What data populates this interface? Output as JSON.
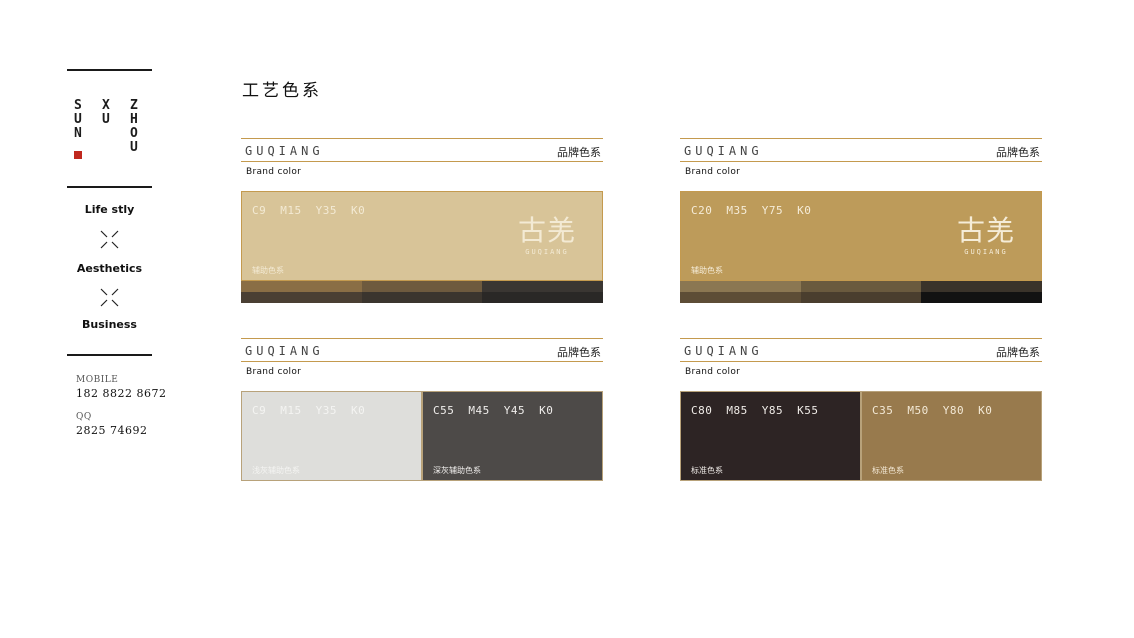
{
  "sidebar": {
    "logo_columns": [
      [
        "S",
        "U",
        "N"
      ],
      [
        "X",
        "U"
      ],
      [
        "Z",
        "H",
        "O",
        "U"
      ]
    ],
    "nav": [
      "Life stly",
      "Aesthetics",
      "Business"
    ],
    "contacts": [
      {
        "label": "MOBILE",
        "value": "182 8822 8672"
      },
      {
        "label": "QQ",
        "value": "2825 74692"
      }
    ]
  },
  "page": {
    "title": "工艺色系"
  },
  "panels": [
    {
      "wordmark": "GUQIANG",
      "tag": "品牌色系",
      "sub": "Brand color",
      "swatches": [
        {
          "cmyk": [
            "C9",
            "M15",
            "Y35",
            "K0"
          ],
          "name": "辅助色系",
          "color": "#d8c498",
          "text_color": "#f3ead4",
          "logo": true
        }
      ],
      "strips": [
        [
          "#8a6e45",
          "#6e5a3e",
          "#3a3632"
        ],
        [
          "#4a3f33",
          "#3b352e",
          "#2a2826"
        ]
      ]
    },
    {
      "wordmark": "GUQIANG",
      "tag": "品牌色系",
      "sub": "Brand color",
      "swatches": [
        {
          "cmyk": [
            "C20",
            "M35",
            "Y75",
            "K0"
          ],
          "name": "辅助色系",
          "color": "#bd9b5a",
          "text_color": "#f5ecd8",
          "logo": true
        }
      ],
      "strips": [
        [
          "#8b7752",
          "#6a5a3e",
          "#3a332a"
        ],
        [
          "#5d4d36",
          "#4a3e2e",
          "#121212"
        ]
      ]
    },
    {
      "wordmark": "GUQIANG",
      "tag": "品牌色系",
      "sub": "Brand color",
      "swatches": [
        {
          "cmyk": [
            "C9",
            "M15",
            "Y35",
            "K0"
          ],
          "name": "浅灰辅助色系",
          "color": "#dededb",
          "text_color": "#f4f4f2",
          "logo": false
        },
        {
          "cmyk": [
            "C55",
            "M45",
            "Y45",
            "K0"
          ],
          "name": "深灰辅助色系",
          "color": "#4d4a48",
          "text_color": "#f0eeec",
          "logo": false
        }
      ],
      "strips": []
    },
    {
      "wordmark": "GUQIANG",
      "tag": "品牌色系",
      "sub": "Brand color",
      "swatches": [
        {
          "cmyk": [
            "C80",
            "M85",
            "Y85",
            "K55"
          ],
          "name": "标准色系",
          "color": "#2d2424",
          "text_color": "#f0ece8",
          "logo": false
        },
        {
          "cmyk": [
            "C35",
            "M50",
            "Y80",
            "K0"
          ],
          "name": "标准色系",
          "color": "#987a4d",
          "text_color": "#f3e9d6",
          "logo": false
        }
      ],
      "strips": []
    }
  ],
  "brand_logo": {
    "mark": "古羌",
    "latin": "GUQIANG"
  }
}
